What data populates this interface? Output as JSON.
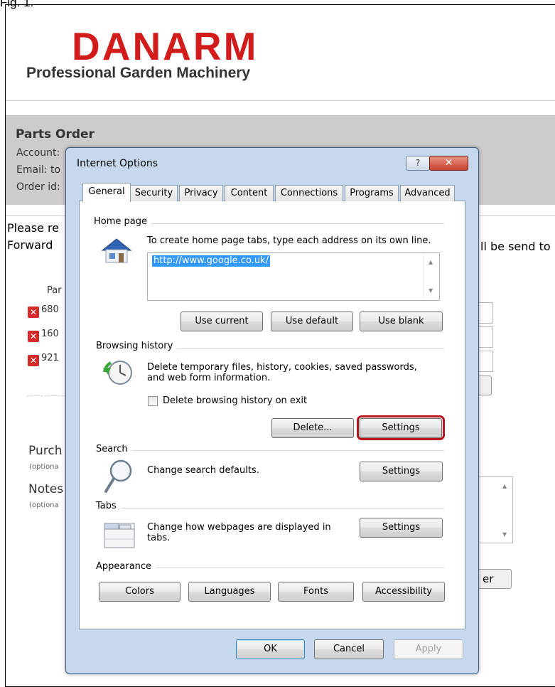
{
  "figure_label": "Fig. 1.",
  "background": {
    "logo": {
      "brand": "DANARM",
      "tagline": "Professional Garden Machinery",
      "brand_color": "#d21c1c"
    },
    "order": {
      "title": "Parts Order",
      "account_label": "Account:",
      "email_label": "Email: to",
      "order_id_label": "Order id:"
    },
    "instructions": {
      "line1": "Please re",
      "line2": "Forward",
      "line2_right": "ll be send to"
    },
    "parts": {
      "header": "Par",
      "rows": [
        {
          "number": "680"
        },
        {
          "number": "160"
        },
        {
          "number": "921"
        }
      ]
    },
    "purchase_label": "Purch",
    "purchase_optional": "(optiona",
    "notes_label": "Notes",
    "notes_optional": "(optiona",
    "order_button_fragment": "er"
  },
  "dialog": {
    "title": "Internet Options",
    "help_glyph": "?",
    "close_glyph": "✕",
    "tabs": [
      "General",
      "Security",
      "Privacy",
      "Content",
      "Connections",
      "Programs",
      "Advanced"
    ],
    "active_tab": "General",
    "home_page": {
      "section": "Home page",
      "instruction": "To create home page tabs, type each address on its own line.",
      "url": "http://www.google.co.uk/",
      "use_current": "Use current",
      "use_default": "Use default",
      "use_blank": "Use blank"
    },
    "browsing_history": {
      "section": "Browsing history",
      "description_line1": "Delete temporary files, history, cookies, saved passwords,",
      "description_line2": "and web form information.",
      "checkbox_label": "Delete browsing history on exit",
      "delete": "Delete...",
      "settings": "Settings"
    },
    "search": {
      "section": "Search",
      "description": "Change search defaults.",
      "settings": "Settings"
    },
    "tabs_section": {
      "section": "Tabs",
      "description_line1": "Change how webpages are displayed in",
      "description_line2": "tabs.",
      "settings": "Settings"
    },
    "appearance": {
      "section": "Appearance",
      "colors": "Colors",
      "languages": "Languages",
      "fonts": "Fonts",
      "accessibility": "Accessibility"
    },
    "footer": {
      "ok": "OK",
      "cancel": "Cancel",
      "apply": "Apply"
    },
    "highlight_color": "#b8151d"
  }
}
